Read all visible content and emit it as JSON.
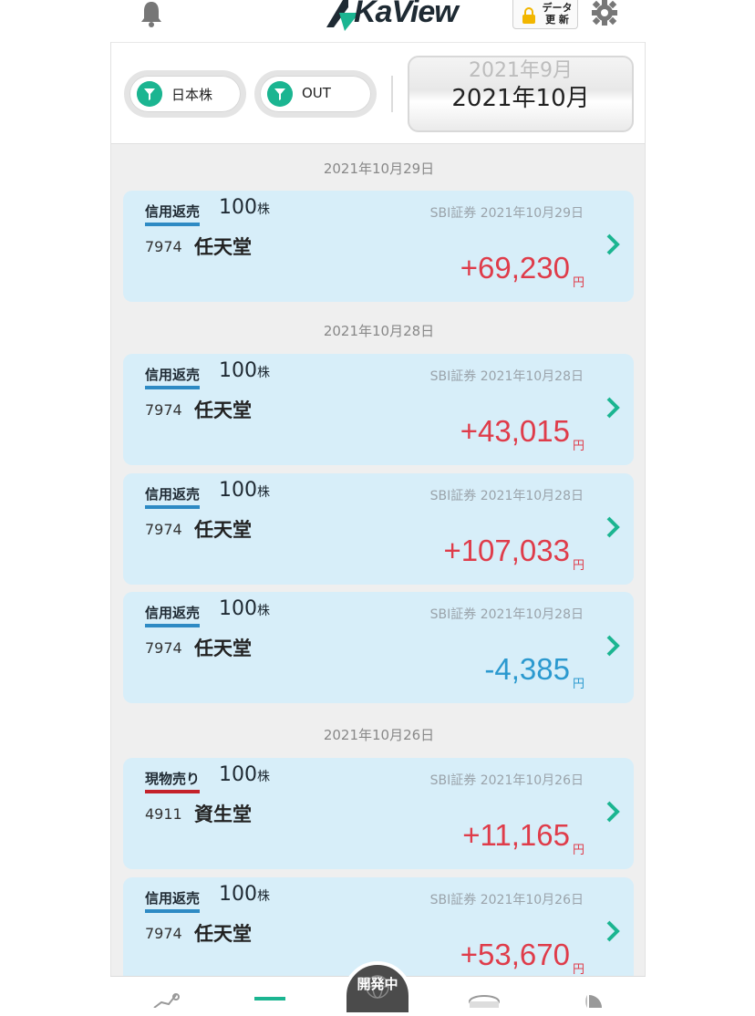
{
  "header": {
    "logo_text": "KaView",
    "data_button_line1": "データ",
    "data_button_line2": "更 新"
  },
  "filters": [
    {
      "label": "日本株"
    },
    {
      "label": "OUT"
    }
  ],
  "month_selector": {
    "previous": "2021年9月",
    "current": "2021年10月"
  },
  "groups": [
    {
      "date": "2021年10月29日",
      "items": [
        {
          "type": "信用返売",
          "qty": "100",
          "unit": "株",
          "broker": "SBI証券 2021年10月29日",
          "code": "7974",
          "name": "任天堂",
          "pl": "+69,230",
          "yen": "円",
          "negative": false
        }
      ]
    },
    {
      "date": "2021年10月28日",
      "items": [
        {
          "type": "信用返売",
          "qty": "100",
          "unit": "株",
          "broker": "SBI証券 2021年10月28日",
          "code": "7974",
          "name": "任天堂",
          "pl": "+43,015",
          "yen": "円",
          "negative": false
        },
        {
          "type": "信用返売",
          "qty": "100",
          "unit": "株",
          "broker": "SBI証券 2021年10月28日",
          "code": "7974",
          "name": "任天堂",
          "pl": "+107,033",
          "yen": "円",
          "negative": false
        },
        {
          "type": "信用返売",
          "qty": "100",
          "unit": "株",
          "broker": "SBI証券 2021年10月28日",
          "code": "7974",
          "name": "任天堂",
          "pl": "-4,385",
          "yen": "円",
          "negative": true
        }
      ]
    },
    {
      "date": "2021年10月26日",
      "items": [
        {
          "type": "現物売り",
          "qty": "100",
          "unit": "株",
          "broker": "SBI証券 2021年10月26日",
          "code": "4911",
          "name": "資生堂",
          "pl": "+11,165",
          "yen": "円",
          "negative": false
        },
        {
          "type": "信用返売",
          "qty": "100",
          "unit": "株",
          "broker": "SBI証券 2021年10月26日",
          "code": "7974",
          "name": "任天堂",
          "pl": "+53,670",
          "yen": "円",
          "negative": false
        }
      ]
    }
  ],
  "tabbar": {
    "dev_badge": "開発中"
  },
  "colors": {
    "accent": "#1bb591",
    "positive": "#df3c4a",
    "negative": "#2b99cf",
    "card_bg": "#d7eef9",
    "margin_tag": "#2d8ac4",
    "cash_tag": "#c4222a"
  }
}
